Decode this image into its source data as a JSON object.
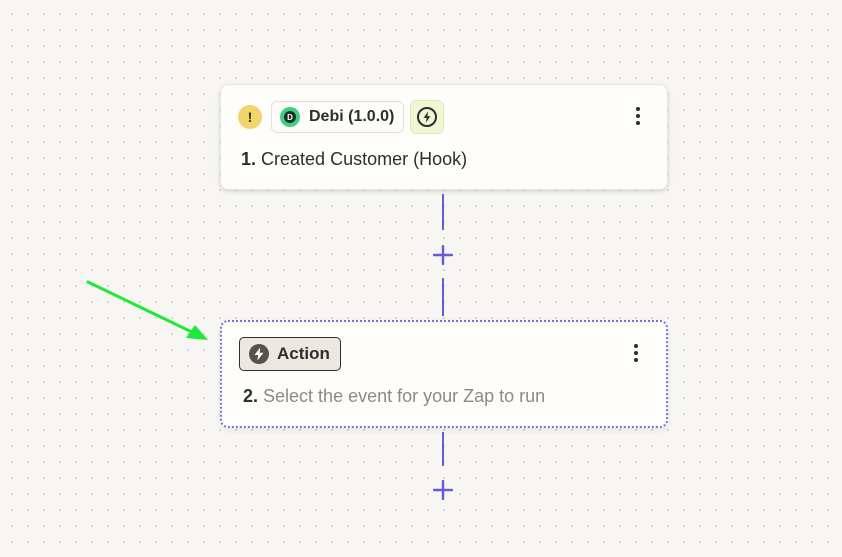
{
  "trigger": {
    "app_name": "Debi (1.0.0)",
    "app_logo_letter": "D",
    "warning_symbol": "!",
    "step_number": "1.",
    "title": "Created Customer (Hook)",
    "icons": [
      "warning-icon",
      "debi-logo-icon",
      "lightning-icon",
      "more-options-icon"
    ]
  },
  "action": {
    "type_label": "Action",
    "step_number": "2.",
    "placeholder_title": "Select the event for your Zap to run",
    "icons": [
      "lightning-icon",
      "more-options-icon"
    ]
  },
  "connectors": {
    "add_step_icon": "plus-icon"
  },
  "colors": {
    "canvas_background": "#f7f6f3",
    "card_background": "#fffdf9",
    "connector": "#6a5bd4",
    "selected_border": "#7b6fd6",
    "warning": "#f2d46d",
    "app_logo": "#3fd17f",
    "trigger_chip": "#eef7d2",
    "action_chip": "#ece8df",
    "annotation_arrow": "#1ee83a"
  }
}
